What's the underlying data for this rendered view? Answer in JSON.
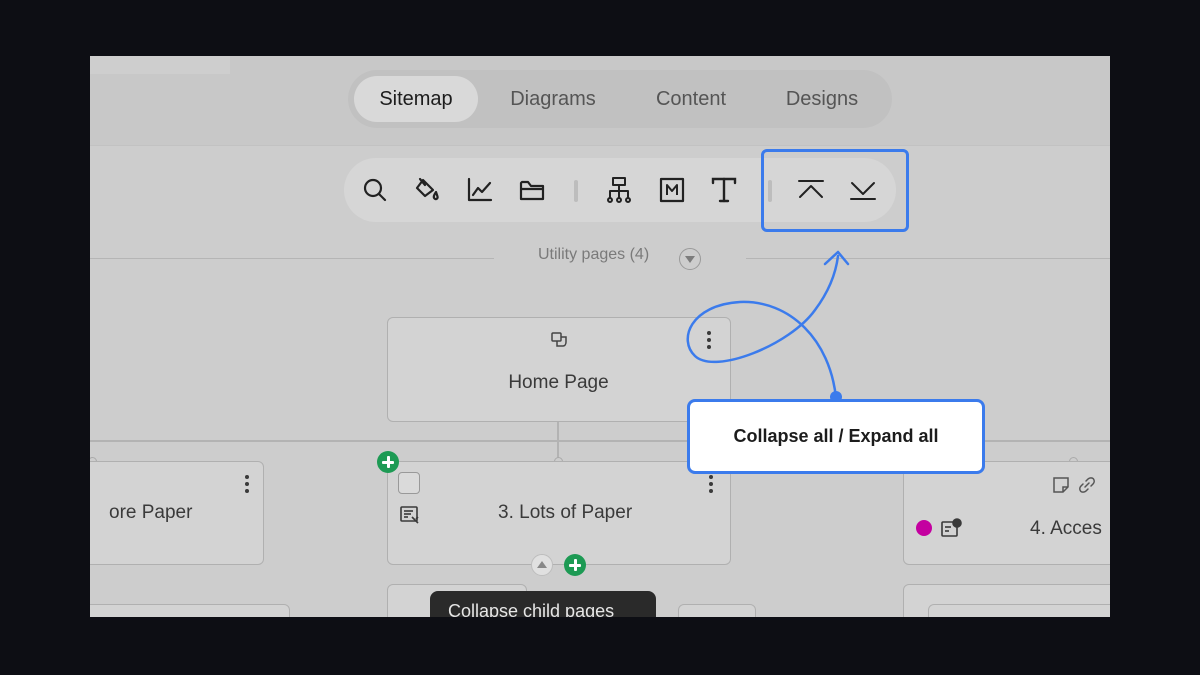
{
  "tabs": [
    {
      "label": "Sitemap",
      "active": true
    },
    {
      "label": "Diagrams",
      "active": false
    },
    {
      "label": "Content",
      "active": false
    },
    {
      "label": "Designs",
      "active": false
    }
  ],
  "toolbar": {
    "tools": [
      "search-icon",
      "paint-bucket-icon",
      "line-chart-icon",
      "folder-icon",
      "sitemap-icon",
      "markdown-icon",
      "text-icon",
      "collapse-all-icon",
      "expand-all-icon"
    ]
  },
  "utility": {
    "label": "Utility pages (4)"
  },
  "cards": {
    "home": {
      "title": "Home Page"
    },
    "left": {
      "title": "ore Paper"
    },
    "middle": {
      "title": "3. Lots of Paper"
    },
    "right": {
      "title": "4. Acces"
    }
  },
  "tooltip": {
    "text": "Collapse child pages"
  },
  "callout": {
    "text": "Collapse all / Expand all"
  },
  "colors": {
    "accent": "#3b7bec",
    "add": "#1d9a54",
    "status_dot": "#c400a0"
  }
}
